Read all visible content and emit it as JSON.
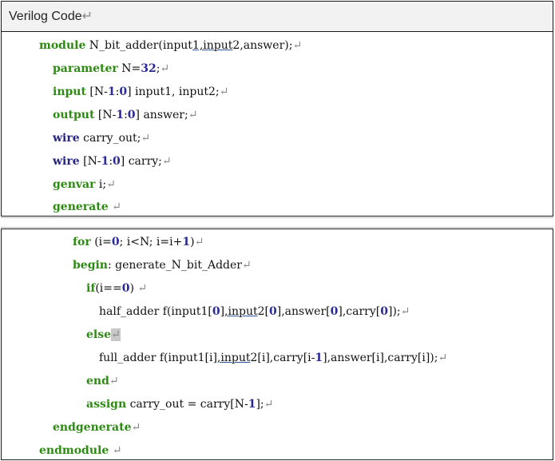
{
  "header": {
    "title": "Verilog Code"
  },
  "paragraph_mark": "↵",
  "code": {
    "l1": {
      "kw": "module",
      "t1": " N_bit_adder(input",
      "u1": "1,input",
      "t2": "2,answer);"
    },
    "l2": {
      "kw": "parameter",
      "t1": " N=",
      "num": "32",
      "t2": ";"
    },
    "l3": {
      "kw": "input",
      "t1": " [N-",
      "n1": "1",
      "t2": ":",
      "n2": "0",
      "t3": "] input1, input2;"
    },
    "l4": {
      "kw": "output",
      "t1": " [N-",
      "n1": "1",
      "t2": ":",
      "n2": "0",
      "t3": "] answer;"
    },
    "l5": {
      "kw": "wire",
      "t1": " carry_out;"
    },
    "l6": {
      "kw": "wire",
      "t1": " [N-",
      "n1": "1",
      "t2": ":",
      "n2": "0",
      "t3": "] carry;"
    },
    "l7": {
      "kw": "genvar",
      "t1": " i;"
    },
    "l8": {
      "kw": "generate",
      "t1": " "
    },
    "l9": {
      "kw": "for",
      "t1": " (i=",
      "n1": "0",
      "t2": "; i<N; i=i+",
      "n2": "1",
      "t3": ")"
    },
    "l10": {
      "kw": "begin",
      "t1": ": generate_N_bit_Adder"
    },
    "l11": {
      "kw": "if",
      "t1": "(i==",
      "n1": "0",
      "t2": ") "
    },
    "l12": {
      "t1": "half_adder f(input1[",
      "n1": "0",
      "u1": "],input",
      "t2": "2[",
      "n2": "0",
      "t3": "],answer[",
      "n3": "0",
      "t4": "],carry[",
      "n4": "0",
      "t5": "]);"
    },
    "l13": {
      "kw": "else"
    },
    "l14": {
      "t1": "full_adder f(input1[i",
      "u1": "],input",
      "t2": "2[i],carry[i-",
      "n1": "1",
      "t3": "],answer[i],carry[i]);"
    },
    "l15": {
      "kw": "end"
    },
    "l16": {
      "kw": "assign",
      "t1": " carry_out = carry[N-",
      "n1": "1",
      "t2": "];"
    },
    "l17": {
      "kw": "endgenerate"
    },
    "l18": {
      "kw": "endmodule",
      "t1": " "
    }
  }
}
